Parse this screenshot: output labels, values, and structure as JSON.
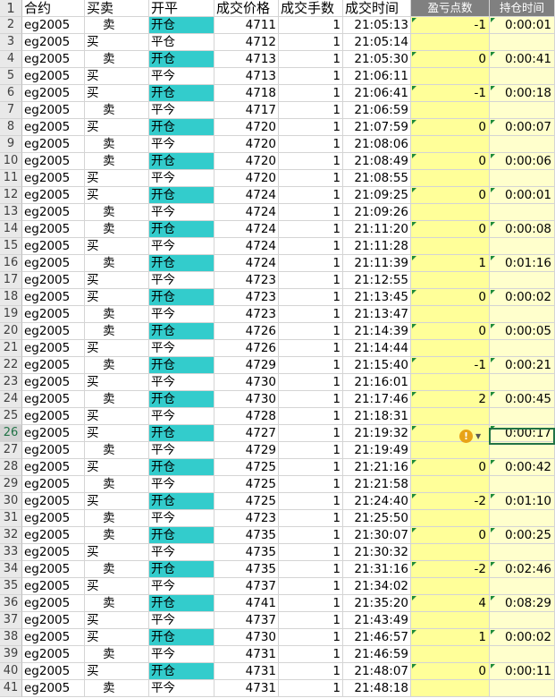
{
  "headers": {
    "row_num": "1",
    "contract": "合约",
    "direction": "买卖",
    "open_close": "开平",
    "price": "成交价格",
    "qty": "成交手数",
    "time": "成交时间",
    "pnl_points": "盈亏点数",
    "hold_time": "持仓时间"
  },
  "colors": {
    "open_fill": "#33cccc",
    "pnl_fill": "#ffff99",
    "hold_fill": "#ffffcc",
    "header_fill": "#808080",
    "selection": "#217346",
    "warning": "#e8a317"
  },
  "selected_cell": "H26",
  "warning_icon": "exclamation-icon",
  "rows": [
    {
      "n": "2",
      "contract": "eg2005",
      "dir": "卖",
      "oc": "开仓",
      "price": "4711",
      "qty": "1",
      "time": "21:05:13",
      "pnl": "-1",
      "hold": "0:00:01"
    },
    {
      "n": "3",
      "contract": "eg2005",
      "dir": "买",
      "oc": "平仓",
      "price": "4712",
      "qty": "1",
      "time": "21:05:14",
      "pnl": "",
      "hold": ""
    },
    {
      "n": "4",
      "contract": "eg2005",
      "dir": "卖",
      "oc": "开仓",
      "price": "4713",
      "qty": "1",
      "time": "21:05:30",
      "pnl": "0",
      "hold": "0:00:41"
    },
    {
      "n": "5",
      "contract": "eg2005",
      "dir": "买",
      "oc": "平今",
      "price": "4713",
      "qty": "1",
      "time": "21:06:11",
      "pnl": "",
      "hold": ""
    },
    {
      "n": "6",
      "contract": "eg2005",
      "dir": "买",
      "oc": "开仓",
      "price": "4718",
      "qty": "1",
      "time": "21:06:41",
      "pnl": "-1",
      "hold": "0:00:18"
    },
    {
      "n": "7",
      "contract": "eg2005",
      "dir": "卖",
      "oc": "平今",
      "price": "4717",
      "qty": "1",
      "time": "21:06:59",
      "pnl": "",
      "hold": ""
    },
    {
      "n": "8",
      "contract": "eg2005",
      "dir": "买",
      "oc": "开仓",
      "price": "4720",
      "qty": "1",
      "time": "21:07:59",
      "pnl": "0",
      "hold": "0:00:07"
    },
    {
      "n": "9",
      "contract": "eg2005",
      "dir": "卖",
      "oc": "平今",
      "price": "4720",
      "qty": "1",
      "time": "21:08:06",
      "pnl": "",
      "hold": ""
    },
    {
      "n": "10",
      "contract": "eg2005",
      "dir": "卖",
      "oc": "开仓",
      "price": "4720",
      "qty": "1",
      "time": "21:08:49",
      "pnl": "0",
      "hold": "0:00:06"
    },
    {
      "n": "11",
      "contract": "eg2005",
      "dir": "买",
      "oc": "平今",
      "price": "4720",
      "qty": "1",
      "time": "21:08:55",
      "pnl": "",
      "hold": ""
    },
    {
      "n": "12",
      "contract": "eg2005",
      "dir": "买",
      "oc": "开仓",
      "price": "4724",
      "qty": "1",
      "time": "21:09:25",
      "pnl": "0",
      "hold": "0:00:01"
    },
    {
      "n": "13",
      "contract": "eg2005",
      "dir": "卖",
      "oc": "平今",
      "price": "4724",
      "qty": "1",
      "time": "21:09:26",
      "pnl": "",
      "hold": ""
    },
    {
      "n": "14",
      "contract": "eg2005",
      "dir": "卖",
      "oc": "开仓",
      "price": "4724",
      "qty": "1",
      "time": "21:11:20",
      "pnl": "0",
      "hold": "0:00:08"
    },
    {
      "n": "15",
      "contract": "eg2005",
      "dir": "买",
      "oc": "平今",
      "price": "4724",
      "qty": "1",
      "time": "21:11:28",
      "pnl": "",
      "hold": ""
    },
    {
      "n": "16",
      "contract": "eg2005",
      "dir": "卖",
      "oc": "开仓",
      "price": "4724",
      "qty": "1",
      "time": "21:11:39",
      "pnl": "1",
      "hold": "0:01:16"
    },
    {
      "n": "17",
      "contract": "eg2005",
      "dir": "买",
      "oc": "平今",
      "price": "4723",
      "qty": "1",
      "time": "21:12:55",
      "pnl": "",
      "hold": ""
    },
    {
      "n": "18",
      "contract": "eg2005",
      "dir": "买",
      "oc": "开仓",
      "price": "4723",
      "qty": "1",
      "time": "21:13:45",
      "pnl": "0",
      "hold": "0:00:02"
    },
    {
      "n": "19",
      "contract": "eg2005",
      "dir": "卖",
      "oc": "平今",
      "price": "4723",
      "qty": "1",
      "time": "21:13:47",
      "pnl": "",
      "hold": ""
    },
    {
      "n": "20",
      "contract": "eg2005",
      "dir": "卖",
      "oc": "开仓",
      "price": "4726",
      "qty": "1",
      "time": "21:14:39",
      "pnl": "0",
      "hold": "0:00:05"
    },
    {
      "n": "21",
      "contract": "eg2005",
      "dir": "买",
      "oc": "平今",
      "price": "4726",
      "qty": "1",
      "time": "21:14:44",
      "pnl": "",
      "hold": ""
    },
    {
      "n": "22",
      "contract": "eg2005",
      "dir": "卖",
      "oc": "开仓",
      "price": "4729",
      "qty": "1",
      "time": "21:15:40",
      "pnl": "-1",
      "hold": "0:00:21"
    },
    {
      "n": "23",
      "contract": "eg2005",
      "dir": "买",
      "oc": "平今",
      "price": "4730",
      "qty": "1",
      "time": "21:16:01",
      "pnl": "",
      "hold": ""
    },
    {
      "n": "24",
      "contract": "eg2005",
      "dir": "卖",
      "oc": "开仓",
      "price": "4730",
      "qty": "1",
      "time": "21:17:46",
      "pnl": "2",
      "hold": "0:00:45"
    },
    {
      "n": "25",
      "contract": "eg2005",
      "dir": "买",
      "oc": "平今",
      "price": "4728",
      "qty": "1",
      "time": "21:18:31",
      "pnl": "",
      "hold": ""
    },
    {
      "n": "26",
      "contract": "eg2005",
      "dir": "买",
      "oc": "开仓",
      "price": "4727",
      "qty": "1",
      "time": "21:19:32",
      "pnl": "",
      "hold": "0:00:17"
    },
    {
      "n": "27",
      "contract": "eg2005",
      "dir": "卖",
      "oc": "平今",
      "price": "4729",
      "qty": "1",
      "time": "21:19:49",
      "pnl": "",
      "hold": ""
    },
    {
      "n": "28",
      "contract": "eg2005",
      "dir": "买",
      "oc": "开仓",
      "price": "4725",
      "qty": "1",
      "time": "21:21:16",
      "pnl": "0",
      "hold": "0:00:42"
    },
    {
      "n": "29",
      "contract": "eg2005",
      "dir": "卖",
      "oc": "平今",
      "price": "4725",
      "qty": "1",
      "time": "21:21:58",
      "pnl": "",
      "hold": ""
    },
    {
      "n": "30",
      "contract": "eg2005",
      "dir": "买",
      "oc": "开仓",
      "price": "4725",
      "qty": "1",
      "time": "21:24:40",
      "pnl": "-2",
      "hold": "0:01:10"
    },
    {
      "n": "31",
      "contract": "eg2005",
      "dir": "卖",
      "oc": "平今",
      "price": "4723",
      "qty": "1",
      "time": "21:25:50",
      "pnl": "",
      "hold": ""
    },
    {
      "n": "32",
      "contract": "eg2005",
      "dir": "卖",
      "oc": "开仓",
      "price": "4735",
      "qty": "1",
      "time": "21:30:07",
      "pnl": "0",
      "hold": "0:00:25"
    },
    {
      "n": "33",
      "contract": "eg2005",
      "dir": "买",
      "oc": "平今",
      "price": "4735",
      "qty": "1",
      "time": "21:30:32",
      "pnl": "",
      "hold": ""
    },
    {
      "n": "34",
      "contract": "eg2005",
      "dir": "卖",
      "oc": "开仓",
      "price": "4735",
      "qty": "1",
      "time": "21:31:16",
      "pnl": "-2",
      "hold": "0:02:46"
    },
    {
      "n": "35",
      "contract": "eg2005",
      "dir": "买",
      "oc": "平今",
      "price": "4737",
      "qty": "1",
      "time": "21:34:02",
      "pnl": "",
      "hold": ""
    },
    {
      "n": "36",
      "contract": "eg2005",
      "dir": "卖",
      "oc": "开仓",
      "price": "4741",
      "qty": "1",
      "time": "21:35:20",
      "pnl": "4",
      "hold": "0:08:29"
    },
    {
      "n": "37",
      "contract": "eg2005",
      "dir": "买",
      "oc": "平今",
      "price": "4737",
      "qty": "1",
      "time": "21:43:49",
      "pnl": "",
      "hold": ""
    },
    {
      "n": "38",
      "contract": "eg2005",
      "dir": "买",
      "oc": "开仓",
      "price": "4730",
      "qty": "1",
      "time": "21:46:57",
      "pnl": "1",
      "hold": "0:00:02"
    },
    {
      "n": "39",
      "contract": "eg2005",
      "dir": "卖",
      "oc": "平今",
      "price": "4731",
      "qty": "1",
      "time": "21:46:59",
      "pnl": "",
      "hold": ""
    },
    {
      "n": "40",
      "contract": "eg2005",
      "dir": "买",
      "oc": "开仓",
      "price": "4731",
      "qty": "1",
      "time": "21:48:07",
      "pnl": "0",
      "hold": "0:00:11"
    },
    {
      "n": "41",
      "contract": "eg2005",
      "dir": "卖",
      "oc": "平今",
      "price": "4731",
      "qty": "1",
      "time": "21:48:18",
      "pnl": "",
      "hold": ""
    }
  ]
}
